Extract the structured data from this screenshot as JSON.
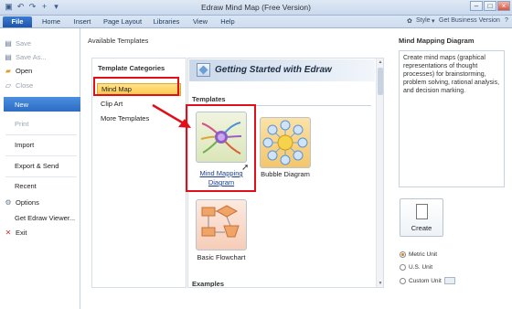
{
  "window": {
    "title": "Edraw Mind Map (Free Version)",
    "min_glyph": "–",
    "max_glyph": "□",
    "close_glyph": "×"
  },
  "ribbon": {
    "tabs": [
      "File",
      "Home",
      "Insert",
      "Page Layout",
      "Libraries",
      "View",
      "Help"
    ],
    "style_label": "Style",
    "business_label": "Get Business Version"
  },
  "nav": {
    "save": "Save",
    "save_as": "Save As...",
    "open": "Open",
    "close": "Close",
    "new": "New",
    "print": "Print",
    "import": "Import",
    "export_send": "Export & Send",
    "recent": "Recent",
    "options": "Options",
    "get_viewer": "Get Edraw Viewer...",
    "exit": "Exit"
  },
  "main": {
    "title": "Available Templates",
    "categories": {
      "title": "Template Categories",
      "items": [
        "Mind Map",
        "Clip Art",
        "More Templates"
      ],
      "selected": "Mind Map"
    },
    "banner": "Getting Started with Edraw",
    "sections": {
      "templates": "Templates",
      "examples": "Examples"
    },
    "templates": [
      {
        "label_line1": "Mind Mapping",
        "label_line2": "Diagram",
        "icon": "mind-map-thumbnail",
        "selected": true
      },
      {
        "label": "Bubble Diagram",
        "icon": "bubble-diagram-thumbnail"
      },
      {
        "label": "Basic Flowchart",
        "icon": "flowchart-thumbnail"
      }
    ]
  },
  "details": {
    "title": "Mind Mapping Diagram",
    "description": "Create mind maps (graphical representations of thought processes) for brainstorming, problem solving, rational analysis, and decision marking.",
    "create_label": "Create",
    "units": [
      {
        "label": "Metric Unit",
        "selected": true
      },
      {
        "label": "U.S. Unit",
        "selected": false
      },
      {
        "label": "Custom Unit",
        "selected": false
      }
    ]
  },
  "colors": {
    "accent": "#2d6cc4",
    "highlight": "#fcc94c",
    "annotation_red": "#e0101a"
  }
}
